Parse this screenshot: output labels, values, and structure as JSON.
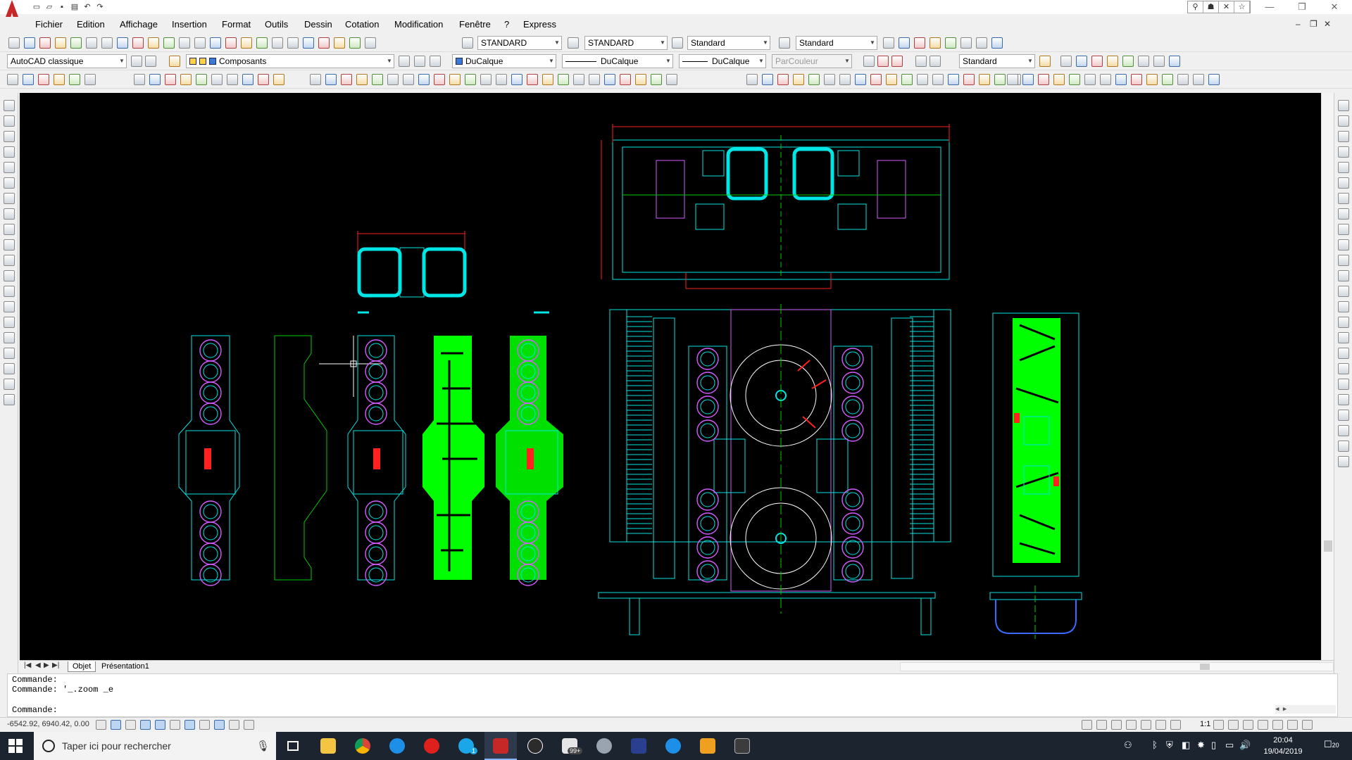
{
  "menu": {
    "items": [
      "Fichier",
      "Edition",
      "Affichage",
      "Insertion",
      "Format",
      "Outils",
      "Dessin",
      "Cotation",
      "Modification",
      "Fenêtre",
      "?",
      "Express"
    ]
  },
  "toolbar1": {
    "text_style": "STANDARD",
    "dim_style": "STANDARD",
    "table_style": "Standard",
    "multileader_style": "Standard"
  },
  "toolbar2": {
    "workspace": "AutoCAD classique",
    "layer": "Composants",
    "color": "DuCalque",
    "linetype": "DuCalque",
    "lineweight": "DuCalque",
    "plotstyle": "ParCouleur",
    "visual_style": "Standard"
  },
  "layout_tabs": [
    "Objet",
    "Présentation1"
  ],
  "command": {
    "line1": "Commande:",
    "line2": "Commande: '_.zoom _e",
    "prompt": "Commande:"
  },
  "status": {
    "coordinates": "-6542.92, 6940.42, 0.00",
    "annotation_scale": "1:1"
  },
  "taskbar": {
    "search_placeholder": "Taper ici pour rechercher",
    "mail_badge": "99+",
    "skype_badge": "1",
    "time": "20:04",
    "date": "19/04/2019",
    "notification_count": "20"
  },
  "colors": {
    "canvas": "#000000",
    "cyan": "#00e5e5",
    "green": "#00ff00",
    "magenta": "#d35cff",
    "red": "#ff2020",
    "taskbar": "#1c2430"
  }
}
